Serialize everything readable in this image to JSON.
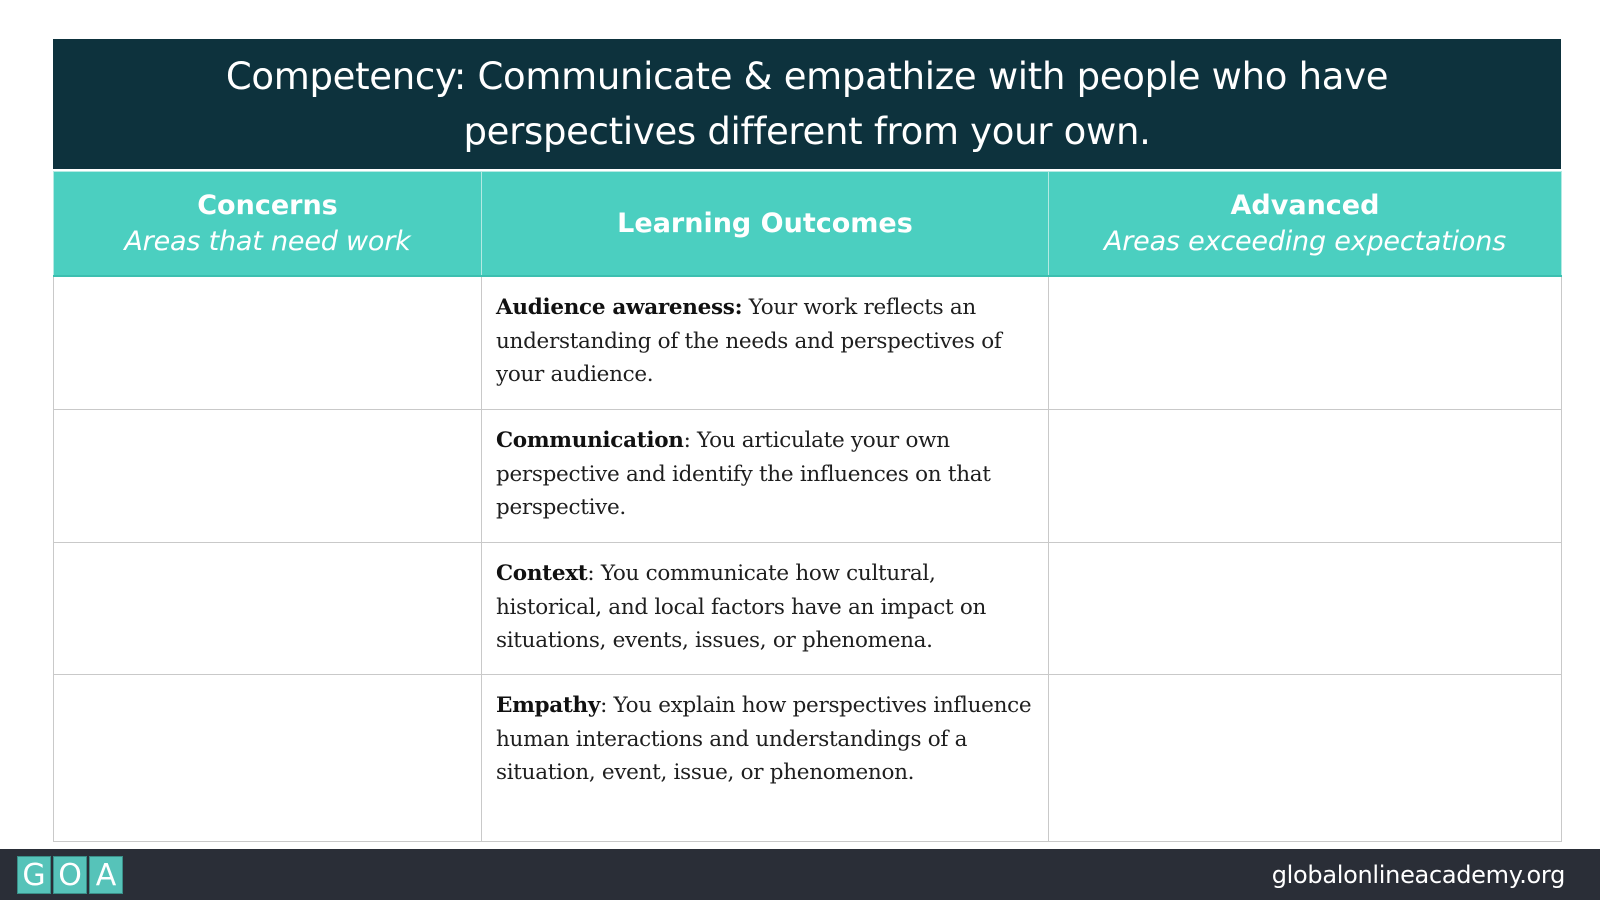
{
  "title": {
    "line1": "Competency: Communicate & empathize with people who have",
    "line2": "perspectives different from your own."
  },
  "columns": [
    {
      "heading": "Concerns",
      "subheading": "Areas that need work"
    },
    {
      "heading": "Learning Outcomes",
      "subheading": ""
    },
    {
      "heading": "Advanced",
      "subheading": "Areas exceeding expectations"
    }
  ],
  "rows": [
    {
      "concerns": "",
      "term": "Audience awareness:",
      "description": " Your work reflects an understanding of the needs and perspectives of your audience.",
      "advanced": ""
    },
    {
      "concerns": "",
      "term": "Communication",
      "description": ": You articulate your own perspective and identify the influences on that perspective.",
      "advanced": ""
    },
    {
      "concerns": "",
      "term": "Context",
      "description": ": You communicate how cultural, historical, and local factors have an impact on situations, events, issues, or phenomena.",
      "advanced": ""
    },
    {
      "concerns": "",
      "term": "Empathy",
      "description": ": You explain how perspectives influence human interactions and understandings of a situation, event, issue, or phenomenon.",
      "advanced": ""
    }
  ],
  "footer": {
    "logo_letters": [
      "G",
      "O",
      "A"
    ],
    "url": "globalonlineacademy.org"
  },
  "colors": {
    "title_bg": "#0d323d",
    "header_teal": "#4bcfc0",
    "footer_bg": "#2a2e37",
    "logo_teal": "#56c3b9"
  }
}
